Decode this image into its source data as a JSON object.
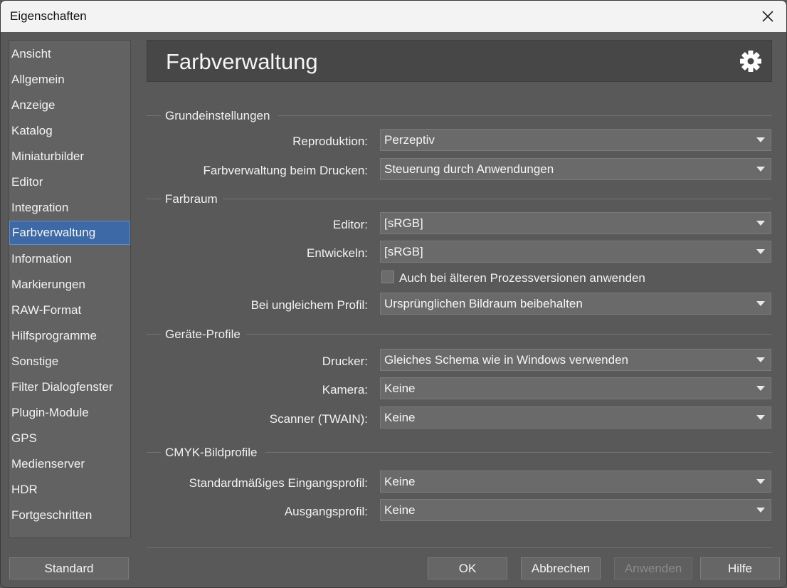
{
  "window": {
    "title": "Eigenschaften"
  },
  "sidebar": {
    "items": [
      {
        "label": "Ansicht"
      },
      {
        "label": "Allgemein"
      },
      {
        "label": "Anzeige"
      },
      {
        "label": "Katalog"
      },
      {
        "label": "Miniaturbilder"
      },
      {
        "label": "Editor"
      },
      {
        "label": "Integration"
      },
      {
        "label": "Farbverwaltung"
      },
      {
        "label": "Information"
      },
      {
        "label": "Markierungen"
      },
      {
        "label": "RAW-Format"
      },
      {
        "label": "Hilfsprogramme"
      },
      {
        "label": "Sonstige"
      },
      {
        "label": "Filter Dialogfenster"
      },
      {
        "label": "Plugin-Module"
      },
      {
        "label": "GPS"
      },
      {
        "label": "Medienserver"
      },
      {
        "label": "HDR"
      },
      {
        "label": "Fortgeschritten"
      }
    ],
    "active_index": 7
  },
  "header": {
    "title": "Farbverwaltung",
    "icon": "gear-icon"
  },
  "sections": {
    "grund": {
      "title": "Grundeinstellungen",
      "reproduktion_label": "Reproduktion:",
      "reproduktion_value": "Perzeptiv",
      "drucken_label": "Farbverwaltung beim Drucken:",
      "drucken_value": "Steuerung durch Anwendungen"
    },
    "farbraum": {
      "title": "Farbraum",
      "editor_label": "Editor:",
      "editor_value": "[sRGB]",
      "entwickeln_label": "Entwickeln:",
      "entwickeln_value": "[sRGB]",
      "checkbox_label": "Auch bei älteren Prozessversionen anwenden",
      "checkbox_checked": false,
      "profil_label": "Bei ungleichem Profil:",
      "profil_value": "Ursprünglichen Bildraum beibehalten"
    },
    "geraete": {
      "title": "Geräte-Profile",
      "drucker_label": "Drucker:",
      "drucker_value": "Gleiches Schema wie in Windows verwenden",
      "kamera_label": "Kamera:",
      "kamera_value": "Keine",
      "scanner_label": "Scanner (TWAIN):",
      "scanner_value": "Keine"
    },
    "cmyk": {
      "title": "CMYK-Bildprofile",
      "eingang_label": "Standardmäßiges Eingangsprofil:",
      "eingang_value": "Keine",
      "ausgang_label": "Ausgangsprofil:",
      "ausgang_value": "Keine"
    }
  },
  "buttons": {
    "standard": "Standard",
    "ok": "OK",
    "abbrechen": "Abbrechen",
    "anwenden": "Anwenden",
    "hilfe": "Hilfe"
  },
  "colors": {
    "active_item": "#3d6aa7",
    "background": "#595959",
    "header": "#474747"
  }
}
